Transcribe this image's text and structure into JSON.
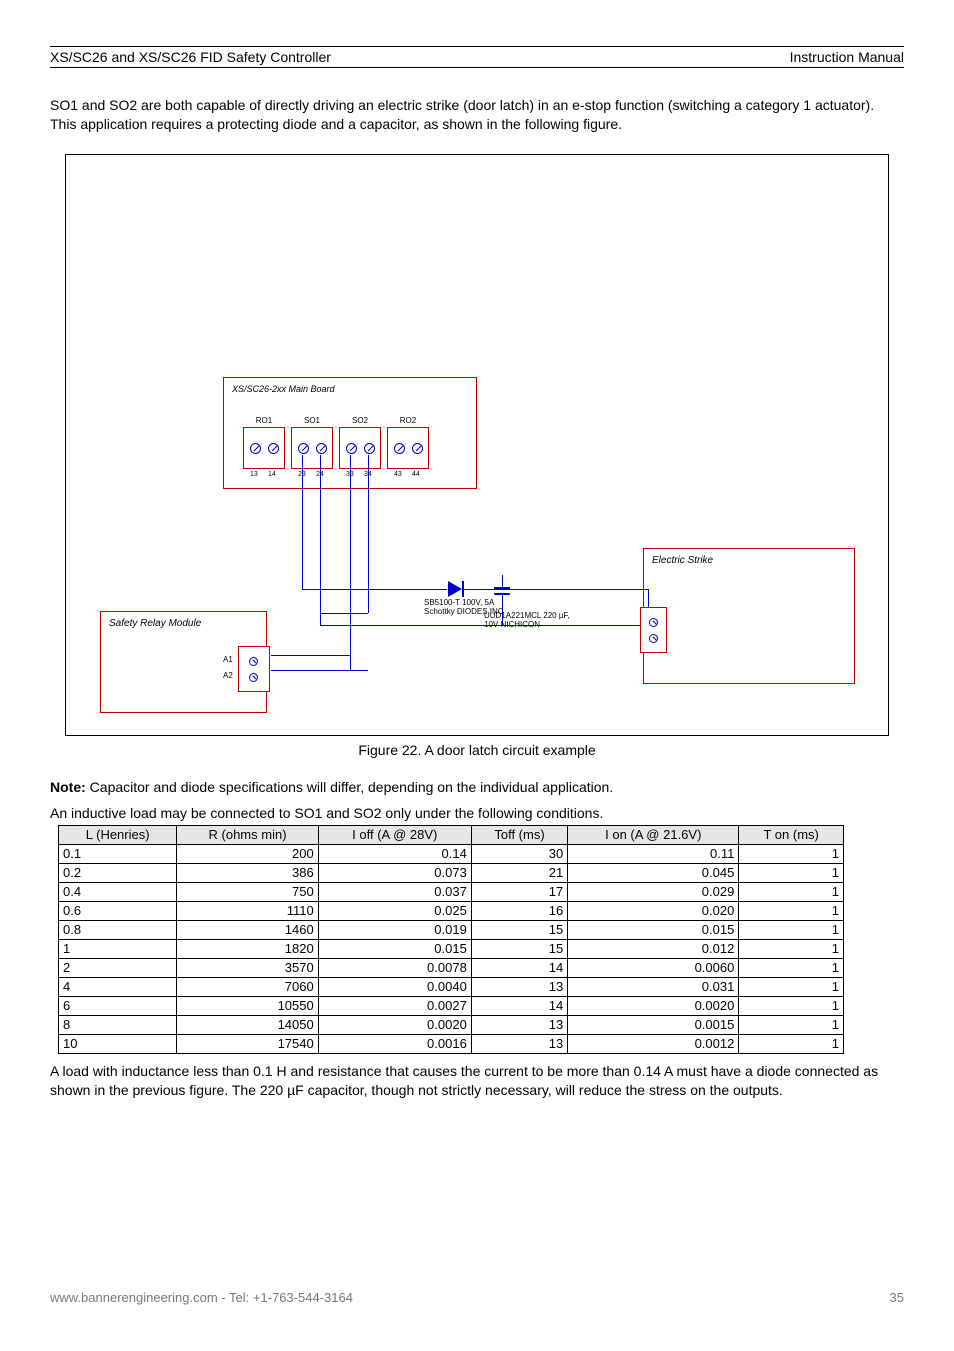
{
  "header": {
    "left": "XS/SC26 and XS/SC26 FID Safety Controller",
    "right": "Instruction Manual"
  },
  "intro": "SO1 and SO2 are both capable of directly driving an electric strike (door latch) in an e-stop function (switching a category 1 actuator). This application requires a protecting diode and a capacitor, as shown in the following figure.",
  "figure": {
    "mainboard_label": "XS/SC26-2xx Main Board",
    "r1": {
      "label": "RO1",
      "top1": "13",
      "top2": "14"
    },
    "so1": {
      "label": "SO1",
      "top1": "23",
      "top2": "24"
    },
    "so2": {
      "label": "SO2",
      "top1": "33",
      "top2": "34"
    },
    "r2": {
      "label": "RO2",
      "top1": "43",
      "top2": "44"
    },
    "diode": "SB5100-T 100V, 5A Schottky DIODES INC",
    "cap": "UUD1A221MCL 220 µF, 10V NICHICON",
    "relay": {
      "title": "Safety Relay Module",
      "pin1": "A1",
      "pin2": "A2"
    },
    "strike": "Electric Strike"
  },
  "fig_caption": "Figure 22. A door latch circuit example",
  "note_text": "Note: Capacitor and diode specifications will differ, depending on the individual application.",
  "tbl_title": "An inductive load may be connected to SO1 and SO2 only under the following conditions.",
  "tbl": {
    "headers": [
      "L (Henries)",
      "R (ohms min)",
      "I off (A @ 28V)",
      "Toff (ms)",
      "I on (A @ 21.6V)",
      "T on (ms)"
    ],
    "rows": [
      [
        "0.1",
        "200",
        "0.14",
        "30",
        "0.11",
        "1"
      ],
      [
        "0.2",
        "386",
        "0.073",
        "21",
        "0.045",
        "1"
      ],
      [
        "0.4",
        "750",
        "0.037",
        "17",
        "0.029",
        "1"
      ],
      [
        "0.6",
        "1110",
        "0.025",
        "16",
        "0.020",
        "1"
      ],
      [
        "0.8",
        "1460",
        "0.019",
        "15",
        "0.015",
        "1"
      ],
      [
        "1",
        "1820",
        "0.015",
        "15",
        "0.012",
        "1"
      ],
      [
        "2",
        "3570",
        "0.0078",
        "14",
        "0.0060",
        "1"
      ],
      [
        "4",
        "7060",
        "0.0040",
        "13",
        "0.031",
        "1"
      ],
      [
        "6",
        "10550",
        "0.0027",
        "14",
        "0.0020",
        "1"
      ],
      [
        "8",
        "14050",
        "0.0020",
        "13",
        "0.0015",
        "1"
      ],
      [
        "10",
        "17540",
        "0.0016",
        "13",
        "0.0012",
        "1"
      ]
    ]
  },
  "after": "A load with inductance less than 0.1 H and resistance that causes the current to be more than 0.14 A must have a diode connected as shown in the previous figure. The 220 µF capacitor, though not strictly necessary, will reduce the stress on the outputs.",
  "footer": {
    "left": "www.bannerengineering.com - Tel: +1-763-544-3164",
    "right": "35"
  }
}
